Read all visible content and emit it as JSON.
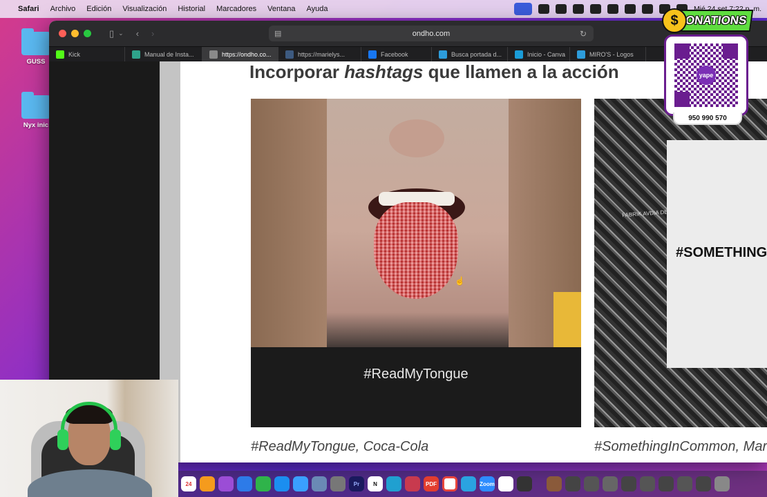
{
  "menubar": {
    "app": "Safari",
    "items": [
      "Archivo",
      "Edición",
      "Visualización",
      "Historial",
      "Marcadores",
      "Ventana",
      "Ayuda"
    ],
    "clock": "Mié 24 set  7:22 p. m."
  },
  "desktop": {
    "icons": [
      {
        "label": "GUSS"
      },
      {
        "label": "Nyx inic"
      }
    ]
  },
  "browser": {
    "url": "ondho.com",
    "tabs": [
      {
        "label": "Kick",
        "color": "#53fc18"
      },
      {
        "label": "Manual de Insta...",
        "color": "#2fa38b"
      },
      {
        "label": "https://ondho.co...",
        "color": "#8a8a8a"
      },
      {
        "label": "https://marielys...",
        "color": "#3d5a80"
      },
      {
        "label": "Facebook",
        "color": "#1877f2"
      },
      {
        "label": "Busca portada d...",
        "color": "#2d9cdb"
      },
      {
        "label": "Inicio - Canva",
        "color": "#1a9cd8"
      },
      {
        "label": "MIRO'S - Logos",
        "color": "#2d9cdb"
      }
    ]
  },
  "page": {
    "heading_pre": "Incorporar ",
    "heading_em": "hashtags",
    "heading_post": " que llamen a la acción",
    "photo1_text": "#ReadMyTongue",
    "photo2_text": "#SOMETHING",
    "caption1": "#ReadMyTongue, Coca-Cola",
    "caption2": "#SomethingInCommon, Mar"
  },
  "donations": {
    "title": "DONATIONS",
    "brand": "yape",
    "phone": "950 990 570"
  },
  "dock": {
    "calendar_day": "24",
    "items": [
      "Pr",
      "N",
      "Zoom",
      "PDF"
    ]
  }
}
